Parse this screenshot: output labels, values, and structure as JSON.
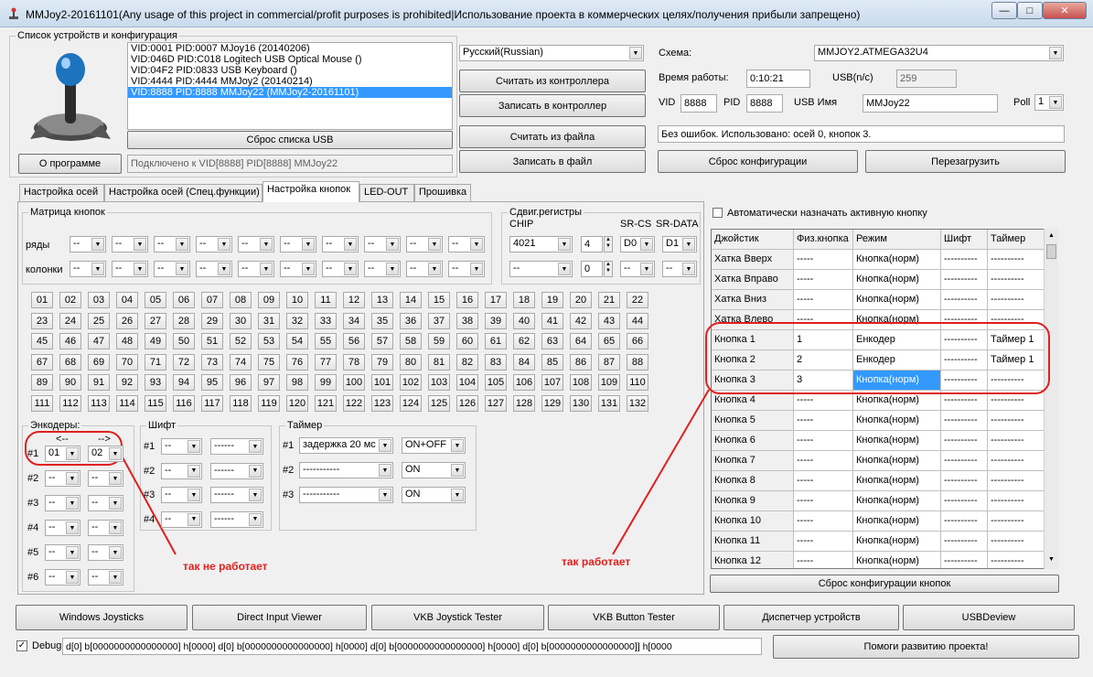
{
  "window": {
    "title": "MMJoy2-20161101(Any usage of this project in commercial/profit purposes is prohibited|Использование проекта в коммерческих целях/получения прибыли запрещено)",
    "min": "—",
    "max": "□",
    "close": "✕"
  },
  "devices": {
    "legend": "Список устройств и конфигурация",
    "items": [
      "VID:0001 PID:0007 MJoy16 (20140206)",
      "VID:046D PID:C018 Logitech USB Optical Mouse ()",
      "VID:04F2 PID:0833 USB Keyboard ()",
      "VID:4444 PID:4444 MMJoy2 (20140214)",
      "VID:8888 PID:8888 MMJoy22 (MMJoy2-20161101)"
    ],
    "reset_label": "Сброс списка USB",
    "about_label": "О программе",
    "status": "Подключено к VID[8888] PID[8888] MMJoy22"
  },
  "language": "Русский(Russian)",
  "controller": {
    "read_label": "Считать из контроллера",
    "write_label": "Записать в контроллер",
    "read_file_label": "Считать из файла",
    "write_file_label": "Записать в файл"
  },
  "config": {
    "scheme_label": "Схема:",
    "scheme": "MMJOY2.ATMEGA32U4",
    "uptime_label": "Время работы:",
    "uptime": "0:10:21",
    "usb_label": "USB(n/c)",
    "usb": "259",
    "vid_label": "VID",
    "vid": "8888",
    "pid_label": "PID",
    "pid": "8888",
    "usbname_label": "USB Имя",
    "usbname": "MMJoy22",
    "poll_label": "Poll",
    "poll": "1",
    "status": "Без ошибок. Использовано: осей  0, кнопок  3.",
    "reset_label": "Сброс конфигурации",
    "reboot_label": "Перезагрузить"
  },
  "tabs": [
    "Настройка осей",
    "Настройка осей (Спец.функции)",
    "Настройка кнопок",
    "LED-OUT",
    "Прошивка"
  ],
  "matrix": {
    "legend": "Матрица кнопок",
    "rows_label": "ряды",
    "cols_label": "колонки",
    "empty": "--"
  },
  "shift_regs": {
    "legend": "Сдвиг.регистры",
    "chip_label": "CHIP",
    "srcs_label": "SR-CS",
    "srdata_label": "SR-DATA",
    "chip1": "4021",
    "n1": "4",
    "cs1": "D0",
    "data1": "D1",
    "chip2": "--",
    "n2": "0",
    "cs2": "--",
    "data2": "--"
  },
  "buttons": [
    "01",
    "02",
    "03",
    "04",
    "05",
    "06",
    "07",
    "08",
    "09",
    "10",
    "11",
    "12",
    "13",
    "14",
    "15",
    "16",
    "17",
    "18",
    "19",
    "20",
    "21",
    "22",
    "23",
    "24",
    "25",
    "26",
    "27",
    "28",
    "29",
    "30",
    "31",
    "32",
    "33",
    "34",
    "35",
    "36",
    "37",
    "38",
    "39",
    "40",
    "41",
    "42",
    "43",
    "44",
    "45",
    "46",
    "47",
    "48",
    "49",
    "50",
    "51",
    "52",
    "53",
    "54",
    "55",
    "56",
    "57",
    "58",
    "59",
    "60",
    "61",
    "62",
    "63",
    "64",
    "65",
    "66",
    "67",
    "68",
    "69",
    "70",
    "71",
    "72",
    "73",
    "74",
    "75",
    "76",
    "77",
    "78",
    "79",
    "80",
    "81",
    "82",
    "83",
    "84",
    "85",
    "86",
    "87",
    "88",
    "89",
    "90",
    "91",
    "92",
    "93",
    "94",
    "95",
    "96",
    "97",
    "98",
    "99",
    "100",
    "101",
    "102",
    "103",
    "104",
    "105",
    "106",
    "107",
    "108",
    "109",
    "110",
    "111",
    "112",
    "113",
    "114",
    "115",
    "116",
    "117",
    "118",
    "119",
    "120",
    "121",
    "122",
    "123",
    "124",
    "125",
    "126",
    "127",
    "128",
    "129",
    "130",
    "131",
    "132"
  ],
  "encoders": {
    "legend": "Энкодеры:",
    "left_arrow": "<--",
    "right_arrow": "-->",
    "rows": [
      "#1",
      "#2",
      "#3",
      "#4",
      "#5",
      "#6"
    ],
    "e1_left": "01",
    "e1_right": "02",
    "empty": "--"
  },
  "shift": {
    "legend": "Шифт",
    "rows": [
      "#1",
      "#2",
      "#3",
      "#4"
    ],
    "empty": "--",
    "dashes": "------"
  },
  "timer": {
    "legend": "Таймер",
    "rows": [
      "#1",
      "#2",
      "#3"
    ],
    "t1_delay": "задержка 20 мс",
    "t1_mode": "ON+OFF",
    "t2_delay": "-----------",
    "t2_mode": "ON",
    "t3_delay": "-----------",
    "t3_mode": "ON"
  },
  "auto_assign_label": "Автоматически назначать активную кнопку",
  "grid": {
    "headers": [
      "Джойстик",
      "Физ.кнопка",
      "Режим",
      "Шифт",
      "Таймер"
    ],
    "rows": [
      [
        "Хатка Вверх",
        "-----",
        "Кнопка(норм)",
        "----------",
        "----------"
      ],
      [
        "Хатка Вправо",
        "-----",
        "Кнопка(норм)",
        "----------",
        "----------"
      ],
      [
        "Хатка Вниз",
        "-----",
        "Кнопка(норм)",
        "----------",
        "----------"
      ],
      [
        "Хатка Влево",
        "-----",
        "Кнопка(норм)",
        "----------",
        "----------"
      ],
      [
        "Кнопка 1",
        "1",
        "Енкодер",
        "----------",
        "Таймер 1"
      ],
      [
        "Кнопка 2",
        "2",
        "Енкодер",
        "----------",
        "Таймер 1"
      ],
      [
        "Кнопка 3",
        "3",
        "Кнопка(норм)",
        "----------",
        "----------"
      ],
      [
        "Кнопка 4",
        "-----",
        "Кнопка(норм)",
        "----------",
        "----------"
      ],
      [
        "Кнопка 5",
        "-----",
        "Кнопка(норм)",
        "----------",
        "----------"
      ],
      [
        "Кнопка 6",
        "-----",
        "Кнопка(норм)",
        "----------",
        "----------"
      ],
      [
        "Кнопка 7",
        "-----",
        "Кнопка(норм)",
        "----------",
        "----------"
      ],
      [
        "Кнопка 8",
        "-----",
        "Кнопка(норм)",
        "----------",
        "----------"
      ],
      [
        "Кнопка 9",
        "-----",
        "Кнопка(норм)",
        "----------",
        "----------"
      ],
      [
        "Кнопка 10",
        "-----",
        "Кнопка(норм)",
        "----------",
        "----------"
      ],
      [
        "Кнопка 11",
        "-----",
        "Кнопка(норм)",
        "----------",
        "----------"
      ],
      [
        "Кнопка 12",
        "-----",
        "Кнопка(норм)",
        "----------",
        "----------"
      ]
    ],
    "reset_label": "Сброс конфигурации кнопок"
  },
  "annotations": {
    "not_works": "так не работает",
    "works": "так работает",
    "color": "#e0201e"
  },
  "bottom": {
    "buttons": [
      "Windows Joysticks",
      "Direct Input Viewer",
      "VKB Joystick Tester",
      "VKB Button Tester",
      "Диспетчер устройств",
      "USBDeview"
    ],
    "debug_label": "Debug",
    "debug_text": "d[0] b[0000000000000000] h[0000]   d[0] b[0000000000000000] h[0000]   d[0] b[0000000000000000] h[0000]   d[0] b[0000000000000000]] h[0000",
    "help_label": "Помоги развитию проекта!"
  }
}
